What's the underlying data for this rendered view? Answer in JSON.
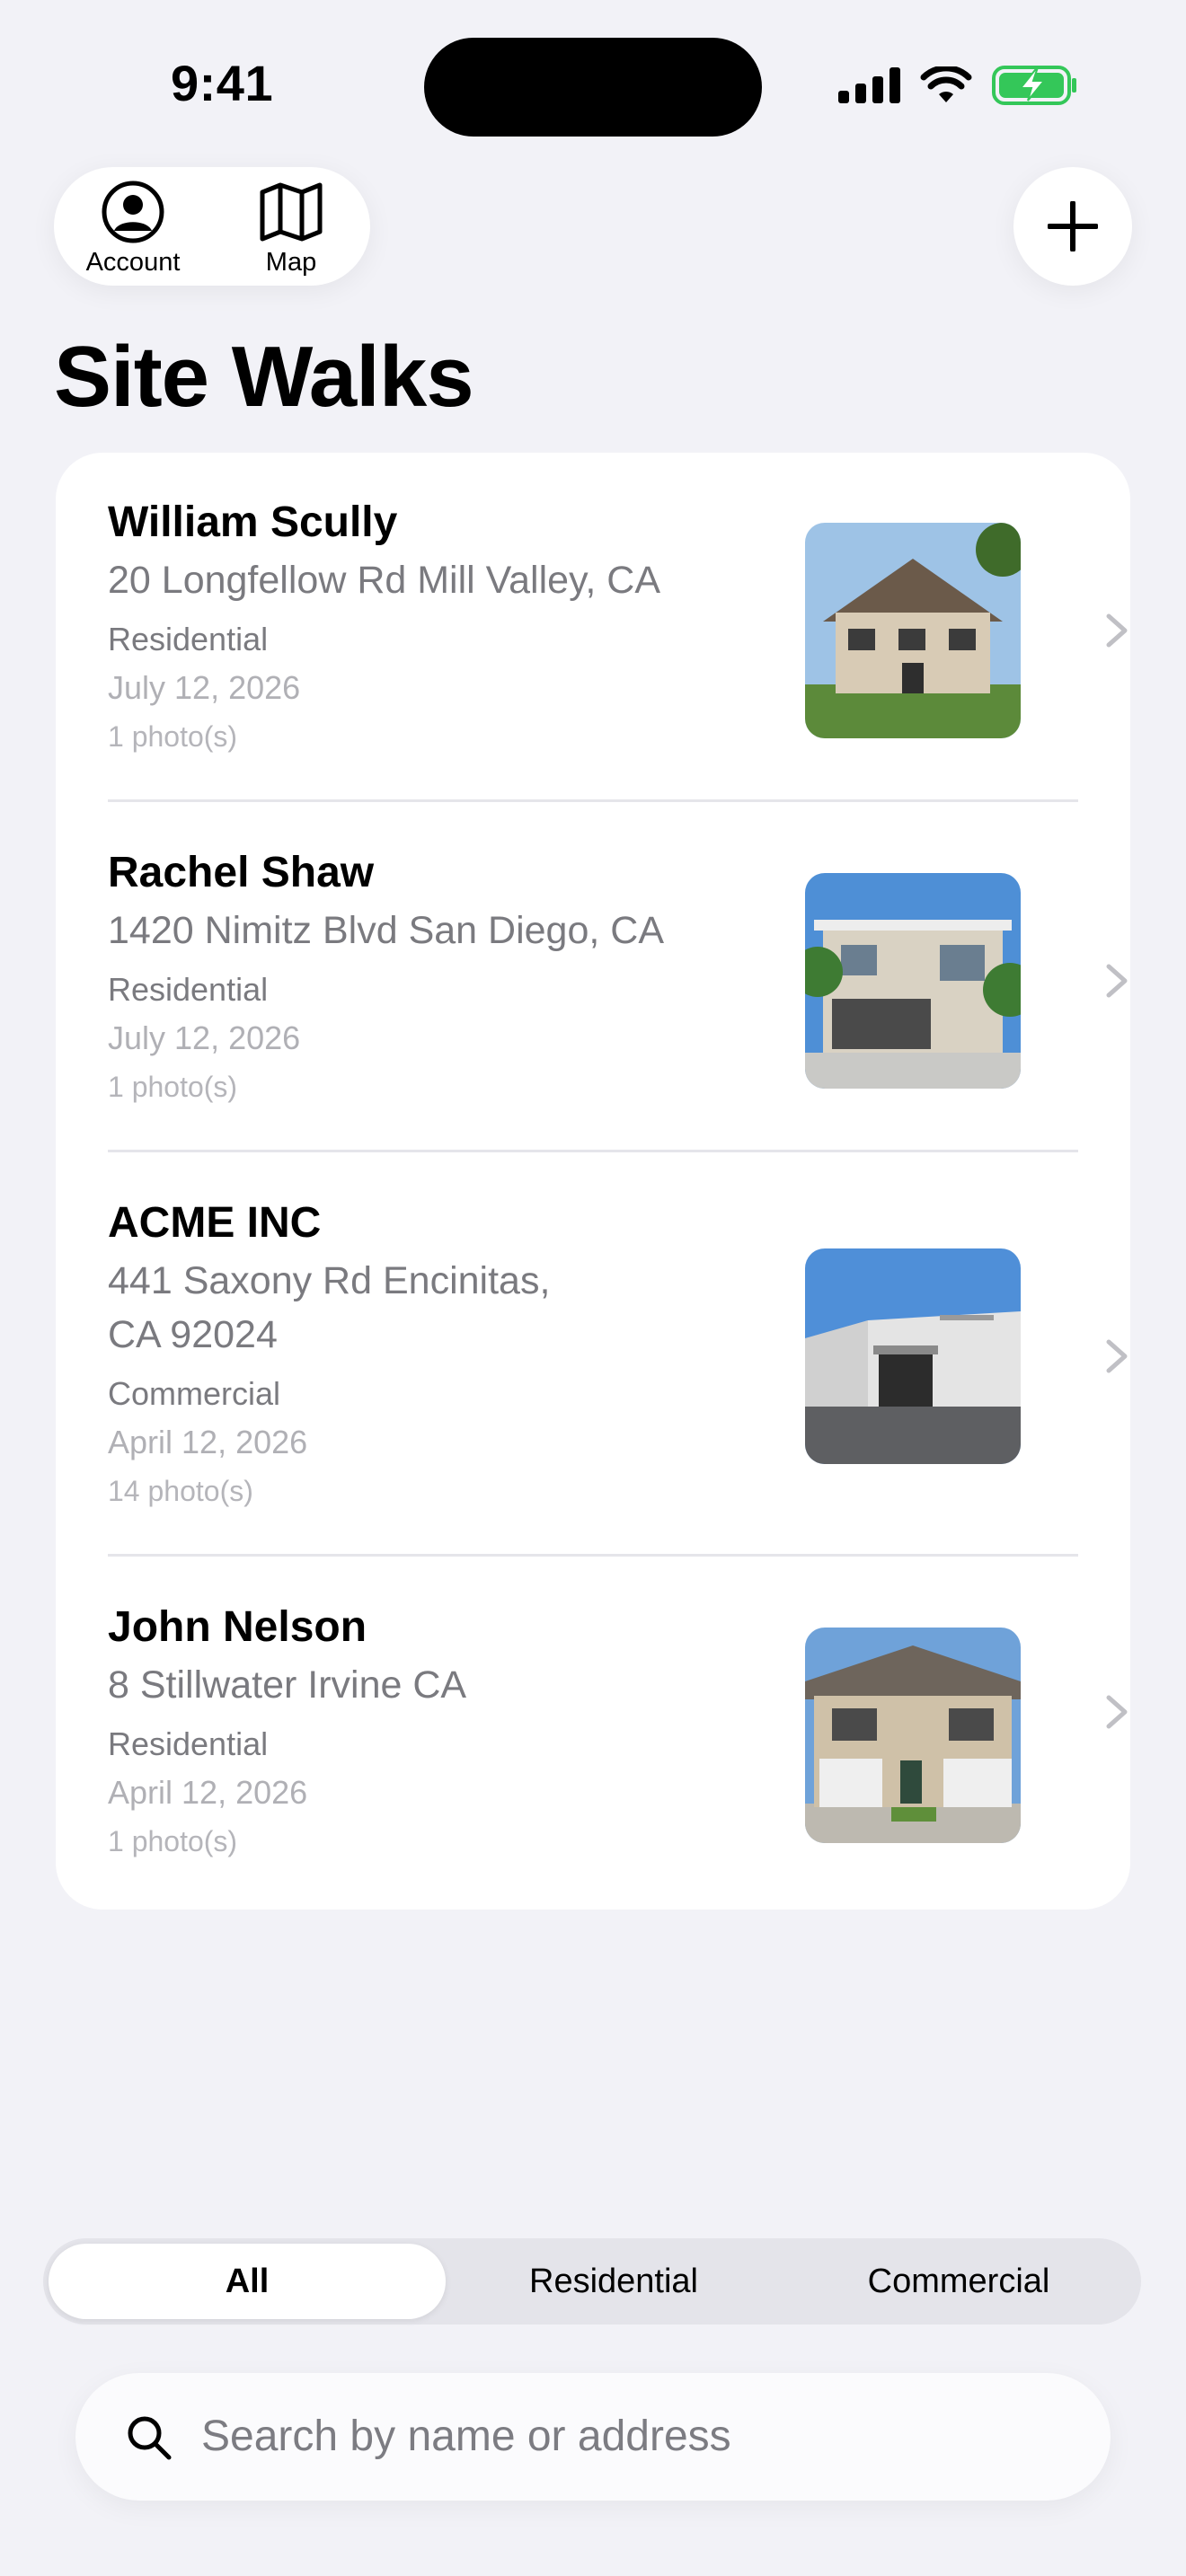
{
  "status_bar": {
    "time": "9:41"
  },
  "toolbar": {
    "account_label": "Account",
    "map_label": "Map"
  },
  "page": {
    "title": "Site Walks"
  },
  "site_walks": [
    {
      "name": "William Scully",
      "address": "20 Longfellow Rd Mill Valley, CA",
      "type": "Residential",
      "date": "July 12, 2026",
      "photos": "1 photo(s)"
    },
    {
      "name": "Rachel Shaw",
      "address": "1420 Nimitz Blvd San Diego, CA",
      "type": "Residential",
      "date": "July 12, 2026",
      "photos": "1 photo(s)"
    },
    {
      "name": "ACME INC",
      "address": "441 Saxony Rd Encinitas, CA  92024",
      "type": "Commercial",
      "date": "April 12, 2026",
      "photos": "14 photo(s)"
    },
    {
      "name": "John Nelson",
      "address": "8 Stillwater Irvine CA",
      "type": "Residential",
      "date": "April 12, 2026",
      "photos": "1 photo(s)"
    }
  ],
  "filter": {
    "options": [
      "All",
      "Residential",
      "Commercial"
    ],
    "selected": "All"
  },
  "search": {
    "placeholder": "Search by name or address"
  },
  "colors": {
    "background": "#F2F2F7",
    "card": "#FFFFFF",
    "secondary_text": "#7A7A7F",
    "battery": "#34C759"
  }
}
